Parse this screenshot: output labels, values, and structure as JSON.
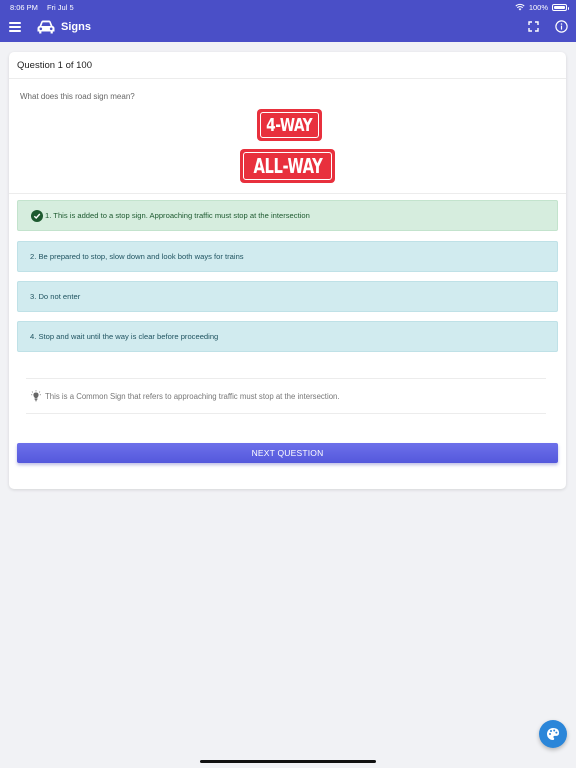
{
  "status_bar": {
    "time": "8:06 PM",
    "date": "Fri Jul 5",
    "battery": "100%"
  },
  "app_bar": {
    "title": "Signs",
    "menu_icon": "menu-icon",
    "car_icon": "car-icon",
    "fullscreen_icon": "fullscreen-icon",
    "info_icon": "info-icon",
    "color": "#4a4fc7"
  },
  "question": {
    "header": "Question 1 of 100",
    "prompt": "What does this road sign mean?",
    "sign": {
      "line1": "4-WAY",
      "line2": "ALL-WAY",
      "color": "#e8303d"
    },
    "options": [
      {
        "label": "1. This is added to a stop sign. Approaching traffic must stop at the intersection",
        "state": "correct"
      },
      {
        "label": "2. Be prepared to stop, slow down and look both ways for trains",
        "state": "default"
      },
      {
        "label": "3. Do not enter",
        "state": "default"
      },
      {
        "label": "4. Stop and wait until the way is clear before proceeding",
        "state": "default"
      }
    ],
    "hint": "This is a Common Sign that refers to approaching traffic must stop at the intersection.",
    "next_label": "NEXT QUESTION"
  },
  "colors": {
    "correct_bg": "#d6edde",
    "option_bg": "#d1ebef",
    "button": "#5f62e3",
    "fab": "#2b86d9"
  },
  "fab_icon": "palette-icon"
}
